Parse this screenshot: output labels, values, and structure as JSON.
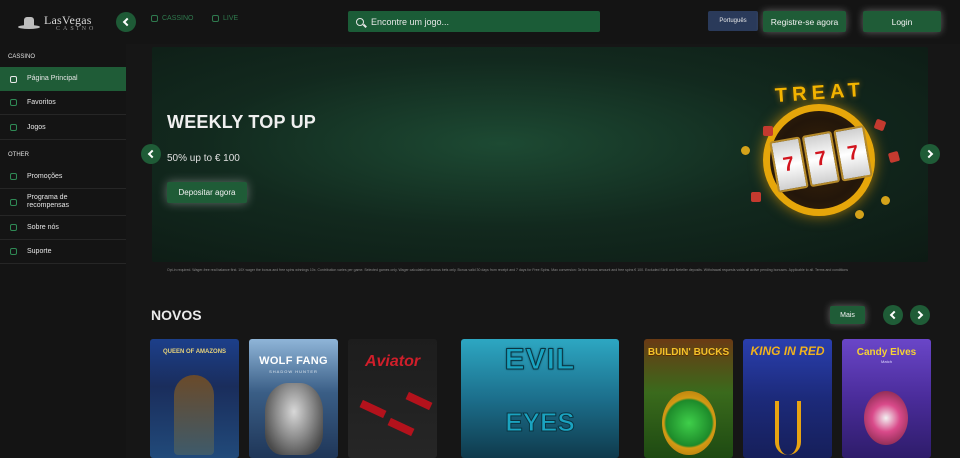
{
  "header": {
    "logo_main": "LasVegas",
    "logo_sub": "CASINO",
    "nav": [
      {
        "label": "CASSINO",
        "icon": "club-icon"
      },
      {
        "label": "LIVE",
        "icon": "live-icon"
      }
    ],
    "search": {
      "placeholder": "Encontre um jogo..."
    },
    "language": "Português",
    "register_label": "Registre-se agora",
    "login_label": "Login"
  },
  "sidebar": {
    "sections": [
      {
        "title": "CASSINO",
        "items": [
          {
            "label": "Página Principal",
            "icon": "grid-icon",
            "active": true
          },
          {
            "label": "Favoritos",
            "icon": "heart-icon",
            "active": false
          },
          {
            "label": "Jogos",
            "icon": "dice-icon",
            "active": false
          }
        ]
      },
      {
        "title": "OTHER",
        "items": [
          {
            "label": "Promoções",
            "icon": "gift-icon",
            "active": false
          },
          {
            "label": "Programa de recompensas",
            "icon": "trophy-icon",
            "active": false
          },
          {
            "label": "Sobre nós",
            "icon": "info-icon",
            "active": false
          },
          {
            "label": "Suporte",
            "icon": "headset-icon",
            "active": false
          }
        ]
      }
    ]
  },
  "banner": {
    "title": "WEEKLY TOP UP",
    "subtitle": "50% up to € 100",
    "cta_label": "Depositar agora",
    "art_word": "TREAT",
    "disclaimer": "Opt-in required. Wager-free real balance first. 10X wager the bonus and free spins winnings 10x. Contribution varies per game. Selected games only. Wager calculated on bonus bets only. Bonus valid 30 days from receipt and 7 days for Free Spins. Max conversion: 3x the bonus amount and free spins € 100. Excluded Skrill and Neteller deposits. Withdrawal requests voids all active pending bonuses. Applicable to all. Terms and conditions"
  },
  "novos": {
    "title": "NOVOS",
    "more_label": "Mais",
    "games": [
      {
        "title": "QUEEN OF AMAZONS",
        "subtitle": ""
      },
      {
        "title": "WOLF FANG",
        "subtitle": "SHADOW HUNTER"
      },
      {
        "title": "Aviator",
        "subtitle": ""
      },
      {
        "title": "EVIL",
        "subtitle": "EYES"
      },
      {
        "title": "BUILDIN' BUCKS",
        "subtitle": ""
      },
      {
        "title": "KING IN RED",
        "subtitle": ""
      },
      {
        "title": "Candy Elves",
        "subtitle": "Match"
      }
    ]
  },
  "colors": {
    "accent_green": "#1f5c37",
    "background": "#161616",
    "language_bg": "#2a3a5a"
  }
}
